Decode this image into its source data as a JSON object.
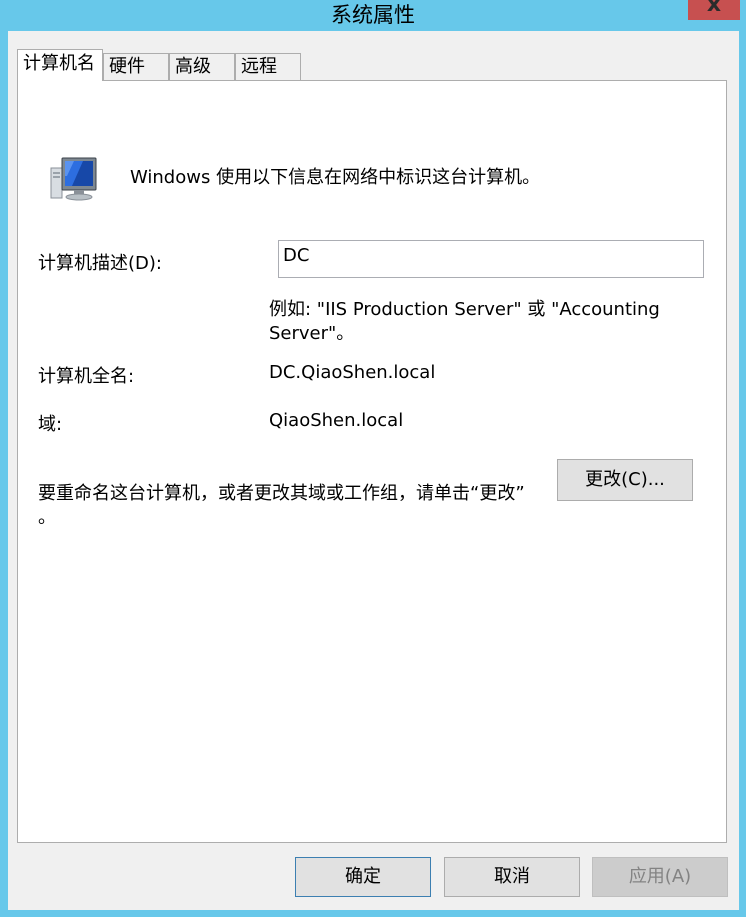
{
  "window": {
    "title": "系统属性",
    "close_symbol": "x"
  },
  "tabs": [
    {
      "label": "计算机名",
      "active": true
    },
    {
      "label": "硬件",
      "active": false
    },
    {
      "label": "高级",
      "active": false
    },
    {
      "label": "远程",
      "active": false
    }
  ],
  "computer_name": {
    "icon": "computer-monitor-icon",
    "intro": "Windows 使用以下信息在网络中标识这台计算机。",
    "description_label": "计算机描述(D):",
    "description_value": "DC",
    "example_line1": "例如: \"IIS Production Server\" 或 \"Accounting",
    "example_line2": "Server\"。",
    "full_name_label": "计算机全名:",
    "full_name_value": "DC.QiaoShen.local",
    "domain_label": "域:",
    "domain_value": "QiaoShen.local",
    "rename_text_line1": "要重命名这台计算机，或者更改其域或工作组，请单击“更改”",
    "rename_text_line2": "。",
    "change_button": "更改(C)..."
  },
  "buttons": {
    "ok": "确定",
    "cancel": "取消",
    "apply": "应用(A)"
  }
}
